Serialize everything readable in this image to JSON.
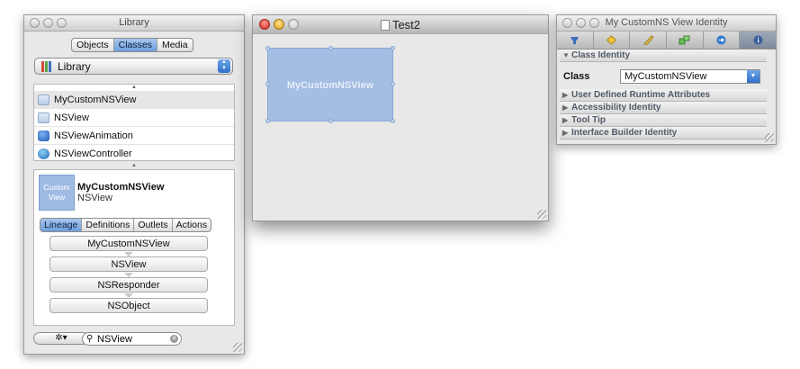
{
  "library": {
    "title": "Library",
    "segments": [
      "Objects",
      "Classes",
      "Media"
    ],
    "selected_segment": "Classes",
    "popup_label": "Library",
    "classes": [
      "MyCustomNSView",
      "NSView",
      "NSViewAnimation",
      "NSViewController"
    ],
    "selected_class": "MyCustomNSView",
    "detail": {
      "thumb_line1": "Custom",
      "thumb_line2": "View",
      "title": "MyCustomNSView",
      "subtitle": "NSView",
      "tabs": [
        "Lineage",
        "Definitions",
        "Outlets",
        "Actions"
      ],
      "selected_tab": "Lineage",
      "lineage": [
        "MyCustomNSView",
        "NSView",
        "NSResponder",
        "NSObject"
      ]
    },
    "search_value": "NSView",
    "gear_label": "✲▾"
  },
  "document": {
    "title": "Test2",
    "custom_view_label": "MyCustomNSView"
  },
  "inspector": {
    "title": "My CustomNS View Identity",
    "sections": {
      "class_identity": "Class Identity",
      "class_label": "Class",
      "class_value": "MyCustomNSView",
      "runtime_attrs": "User Defined Runtime Attributes",
      "accessibility": "Accessibility Identity",
      "tooltip": "Tool Tip",
      "ib_identity": "Interface Builder Identity"
    }
  },
  "colors": {
    "selection_blue": "#6e9edb",
    "custom_view_fill": "#a4bde2",
    "close_red": "#d4261a",
    "minimize_yellow": "#e4a11a"
  }
}
